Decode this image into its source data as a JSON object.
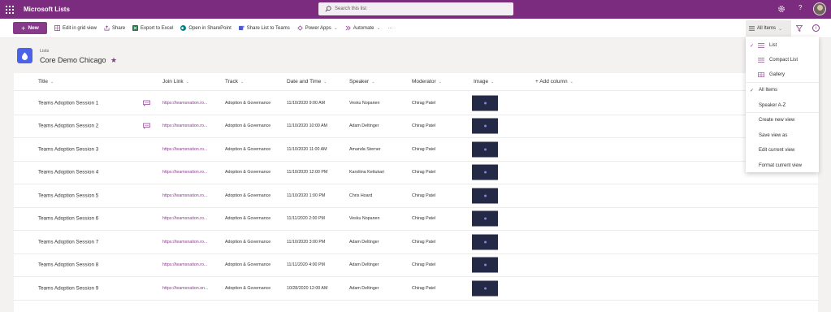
{
  "app": {
    "title": "Microsoft Lists",
    "search_placeholder": "Search this list",
    "help_label": "?"
  },
  "commandbar": {
    "new_label": "New",
    "edit_grid_label": "Edit in grid view",
    "share_label": "Share",
    "export_label": "Export to Excel",
    "open_sharepoint_label": "Open in SharePoint",
    "share_teams_label": "Share List to Teams",
    "power_apps_label": "Power Apps",
    "automate_label": "Automate",
    "more_label": "···",
    "view_selector_label": "All Items",
    "info_label": "i"
  },
  "header": {
    "breadcrumb": "Lists",
    "title": "Core Demo Chicago",
    "favorite_glyph": "★"
  },
  "table": {
    "columns": {
      "title": "Title",
      "join_link": "Join Link",
      "track": "Track",
      "date_time": "Date and Time",
      "speaker": "Speaker",
      "moderator": "Moderator",
      "image": "Image",
      "add_column": "+ Add column"
    },
    "rows": [
      {
        "title": "Teams Adoption Session 1",
        "link": "https://teamsnation.ro...",
        "track": "Adoption & Governance",
        "date": "11/10/2020 9:00 AM",
        "speaker": "Vesku Nopanen",
        "moderator": "Chirag Patel",
        "has_comment": true
      },
      {
        "title": "Teams Adoption Session 2",
        "link": "https://teamsnation.ro...",
        "track": "Adoption & Governance",
        "date": "11/10/2020 10:00 AM",
        "speaker": "Adam Deltinger",
        "moderator": "Chirag Patel",
        "has_comment": true
      },
      {
        "title": "Teams Adoption Session 3",
        "link": "https://teamsnation.ro...",
        "track": "Adoption & Governance",
        "date": "11/10/2020 11:00 AM",
        "speaker": "Amanda Sterner",
        "moderator": "Chirag Patel",
        "has_comment": false
      },
      {
        "title": "Teams Adoption Session 4",
        "link": "https://teamsnation.ro...",
        "track": "Adoption & Governance",
        "date": "11/10/2020 12:00 PM",
        "speaker": "Karoliina Kettukari",
        "moderator": "Chirag Patel",
        "has_comment": false
      },
      {
        "title": "Teams Adoption Session 5",
        "link": "https://teamsnation.ro...",
        "track": "Adoption & Governance",
        "date": "11/10/2020 1:00 PM",
        "speaker": "Chris Hoard",
        "moderator": "Chirag Patel",
        "has_comment": false
      },
      {
        "title": "Teams Adoption Session 6",
        "link": "https://teamsnation.ro...",
        "track": "Adoption & Governance",
        "date": "11/11/2020 2:00 PM",
        "speaker": "Vesku Nopanen",
        "moderator": "Chirag Patel",
        "has_comment": false
      },
      {
        "title": "Teams Adoption Session 7",
        "link": "https://teamsnation.ro...",
        "track": "Adoption & Governance",
        "date": "11/10/2020 3:00 PM",
        "speaker": "Adam Deltinger",
        "moderator": "Chirag Patel",
        "has_comment": false
      },
      {
        "title": "Teams Adoption Session 8",
        "link": "https://teamsnation.ro...",
        "track": "Adoption & Governance",
        "date": "11/11/2020 4:00 PM",
        "speaker": "Adam Deltinger",
        "moderator": "Chirag Patel",
        "has_comment": false
      },
      {
        "title": "Teams Adoption Session 9",
        "link": "https://teamsnation.on...",
        "track": "Adoption & Governance",
        "date": "10/28/2020 12:00 AM",
        "speaker": "Adam Deltinger",
        "moderator": "Chirag Patel",
        "has_comment": false
      }
    ]
  },
  "view_menu": {
    "check_glyph": "✓",
    "items": [
      {
        "label": "List",
        "checked": true
      },
      {
        "label": "Compact List",
        "checked": false
      },
      {
        "label": "Gallery",
        "checked": false
      },
      {
        "label": "All Items",
        "checked": true
      },
      {
        "label": "Speaker A-Z",
        "checked": false
      },
      {
        "label": "Create new view",
        "checked": false
      },
      {
        "label": "Save view as",
        "checked": false
      },
      {
        "label": "Edit current view",
        "checked": false
      },
      {
        "label": "Format current view",
        "checked": false
      }
    ]
  },
  "colors": {
    "suite_bar": "#7b2c7e",
    "accent": "#883a8a",
    "list_icon": "#4b63e8",
    "link": "#8a3d8d"
  }
}
